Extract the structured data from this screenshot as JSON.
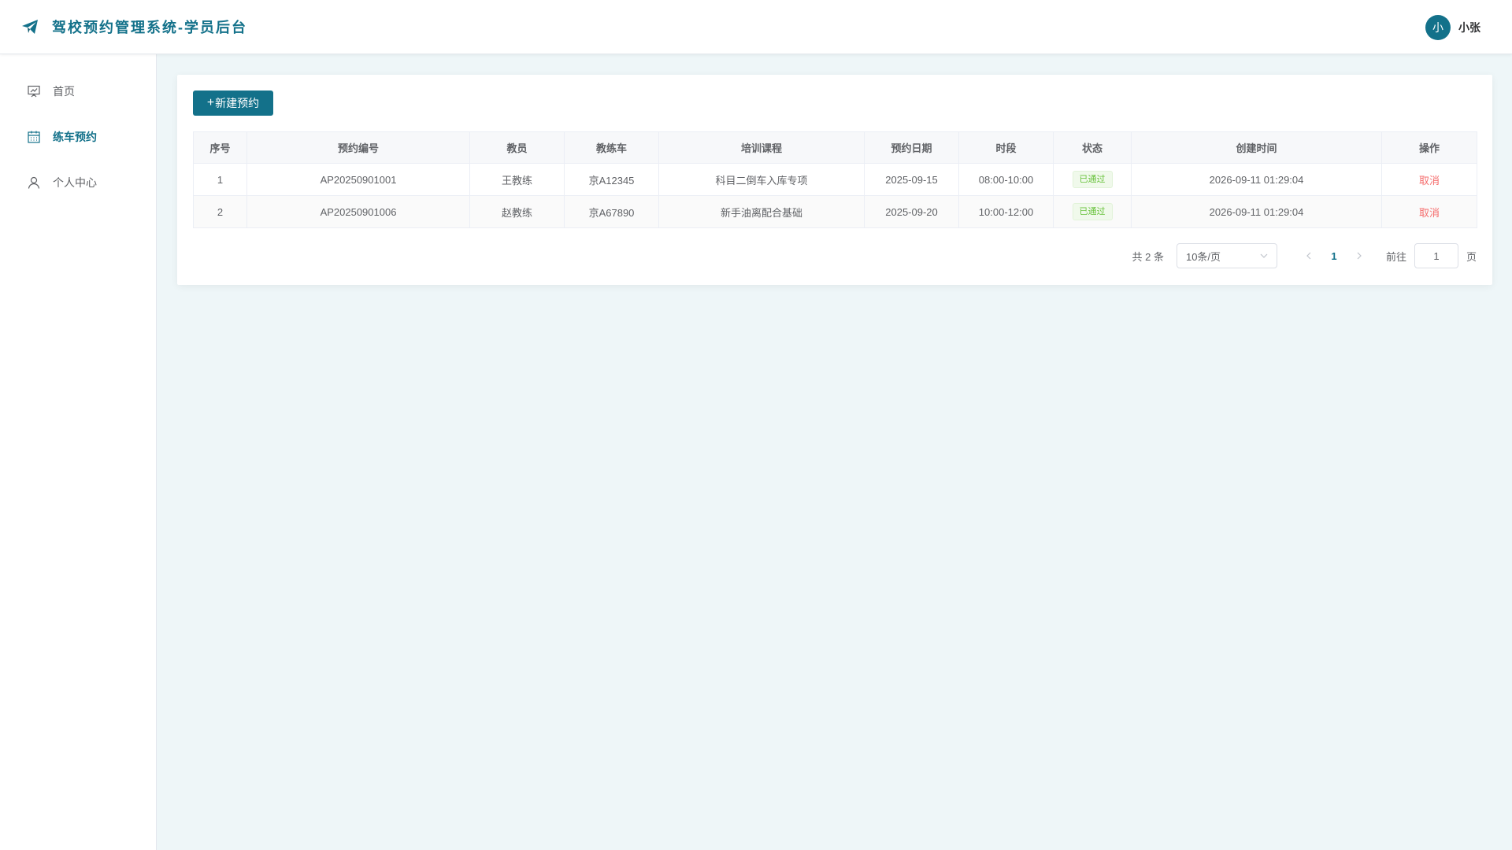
{
  "header": {
    "title": "驾校预约管理系统-学员后台",
    "user_avatar": "小",
    "user_name": "小张"
  },
  "sidebar": {
    "items": [
      {
        "label": "首页",
        "icon": "presentation-icon",
        "active": false
      },
      {
        "label": "练车预约",
        "icon": "calendar-icon",
        "active": true
      },
      {
        "label": "个人中心",
        "icon": "user-icon",
        "active": false
      }
    ]
  },
  "toolbar": {
    "new_label": "新建预约"
  },
  "table": {
    "headers": [
      "序号",
      "预约编号",
      "教员",
      "教练车",
      "培训课程",
      "预约日期",
      "时段",
      "状态",
      "创建时间",
      "操作"
    ],
    "rows": [
      {
        "index": "1",
        "code": "AP20250901001",
        "coach": "王教练",
        "car": "京A12345",
        "course": "科目二倒车入库专项",
        "date": "2025-09-15",
        "slot": "08:00-10:00",
        "status": "已通过",
        "created": "2026-09-11 01:29:04",
        "action": "取消"
      },
      {
        "index": "2",
        "code": "AP20250901006",
        "coach": "赵教练",
        "car": "京A67890",
        "course": "新手油离配合基础",
        "date": "2025-09-20",
        "slot": "10:00-12:00",
        "status": "已通过",
        "created": "2026-09-11 01:29:04",
        "action": "取消"
      }
    ]
  },
  "pagination": {
    "total": "共 2 条",
    "page_size": "10条/页",
    "current": "1",
    "goto_label": "前往",
    "goto_value": "1",
    "page_suffix": "页"
  },
  "colors": {
    "primary": "#13718a",
    "danger": "#f56c6c",
    "success": "#67c23a",
    "background": "#eef6f8"
  }
}
